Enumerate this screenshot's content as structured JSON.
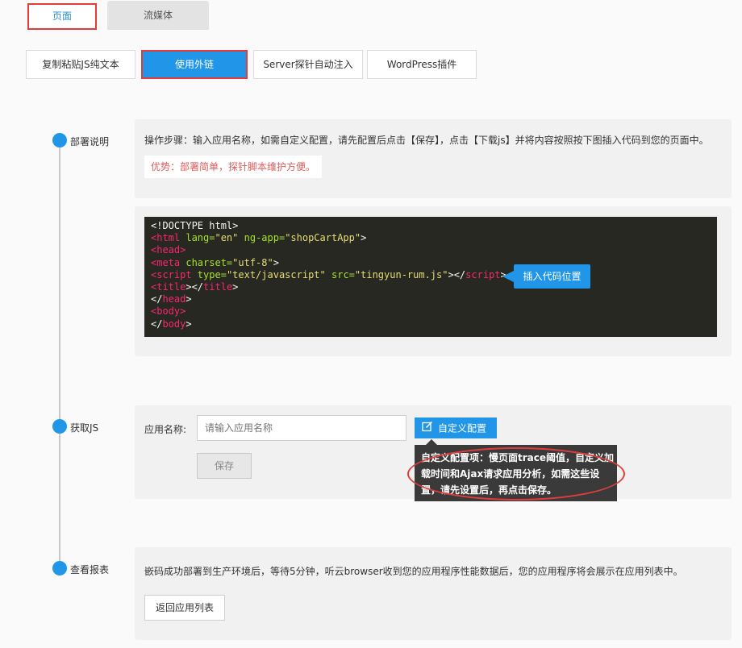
{
  "tabs": {
    "page": "页面",
    "streaming": "流媒体"
  },
  "methods": [
    {
      "label": "复制粘贴JS纯文本",
      "active": false
    },
    {
      "label": "使用外链",
      "active": true
    },
    {
      "label": "Server探针自动注入",
      "active": false
    },
    {
      "label": "WordPress插件",
      "active": false
    }
  ],
  "steps": {
    "deploy": {
      "title": "部署说明",
      "instruction": "操作步骤：输入应用名称，如需自定义配置，请先配置后点击【保存】，点击【下载js】并将内容按照按下图插入代码到您的页面中。",
      "advantage": "优势：部署简单，探针脚本维护方便。"
    },
    "get_js": {
      "title": "获取JS",
      "app_name_label": "应用名称:",
      "app_name_placeholder": "请输入应用名称",
      "custom_config_button": "自定义配置",
      "save_button": "保存",
      "tooltip": "自定义配置项：慢页面trace阈值，自定义加载时间和Ajax请求应用分析，如需这些设置，请先设置后，再点击保存。"
    },
    "view_report": {
      "title": "查看报表",
      "text": "嵌码成功部署到生产环境后，等待5分钟，听云browser收到您的应用程序性能数据后，您的应用程序将会展示在应用列表中。",
      "back_button": "返回应用列表"
    }
  },
  "code": {
    "l1": "<!DOCTYPE html>",
    "l2_tag_open": "<html",
    "l2_a1": " lang=",
    "l2_v1": "\"en\"",
    "l2_a2": " ng-app=",
    "l2_v2": "\"shopCartApp\"",
    "l2_end": ">",
    "l3": "<head>",
    "l4_tag": "<meta",
    "l4_a": " charset=",
    "l4_v": "\"utf-8\"",
    "l4_end": ">",
    "l5_tag": "<script",
    "l5_a1": " type=",
    "l5_v1": "\"text/javascript\"",
    "l5_a2": " src=",
    "l5_v2": "\"tingyun-rum.js\"",
    "l5_mid": "></",
    "l5_tag2": "script",
    "l5_end": ">",
    "l6_tag": "<title",
    "l6_mid": "></",
    "l6_tag2": "title",
    "l6_end": ">",
    "l7_a": "</",
    "l7_tag": "head",
    "l7_end": ">",
    "l8": "<body>",
    "l9_a": "</",
    "l9_tag": "body",
    "l9_end": ">",
    "callout": "插入代码位置"
  },
  "colors": {
    "accent": "#2196e8",
    "highlight_border": "#e03c3c",
    "advantage_text": "#e05a5a",
    "code_bg": "#272822"
  }
}
